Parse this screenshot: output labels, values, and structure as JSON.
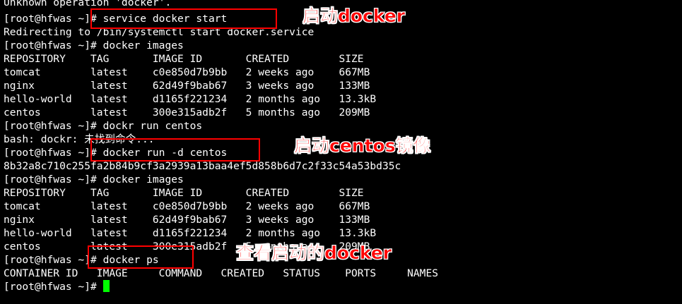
{
  "terminal": {
    "lines": [
      "Unknown operation 'docker'.",
      "[root@hfwas ~]# service docker start",
      "Redirecting to /bin/systemctl start docker.service",
      "[root@hfwas ~]# docker images",
      "REPOSITORY    TAG       IMAGE ID       CREATED        SIZE",
      "tomcat        latest    c0e850d7b9bb   2 weeks ago    667MB",
      "nginx         latest    62d49f9bab67   3 weeks ago    133MB",
      "hello-world   latest    d1165f221234   2 months ago   13.3kB",
      "centos        latest    300e315adb2f   5 months ago   209MB",
      "[root@hfwas ~]# dockr run centos",
      "bash: dockr: 未找到命令...",
      "[root@hfwas ~]# docker run -d centos",
      "8b32a8c710c255fa2b84b9cf3a2939a13baa4ef5d858b6d7c2f33c54a53bd35c",
      "[root@hfwas ~]# docker images",
      "REPOSITORY    TAG       IMAGE ID       CREATED        SIZE",
      "tomcat        latest    c0e850d7b9bb   2 weeks ago    667MB",
      "nginx         latest    62d49f9bab67   3 weeks ago    133MB",
      "hello-world   latest    d1165f221234   2 months ago   13.3kB",
      "centos        latest    300e315adb2f   5 months ago   209MB",
      "[root@hfwas ~]# docker ps",
      "CONTAINER ID   IMAGE     COMMAND   CREATED   STATUS    PORTS     NAMES",
      "[root@hfwas ~]# "
    ],
    "cursor_color": "#00ff00",
    "text_color": "#ffffff",
    "background_color": "#000000"
  },
  "annotations": {
    "color": "#ff0000",
    "start_docker": "启动docker",
    "start_centos": "启动centos镜像",
    "view_docker": "查看启动的docker"
  }
}
